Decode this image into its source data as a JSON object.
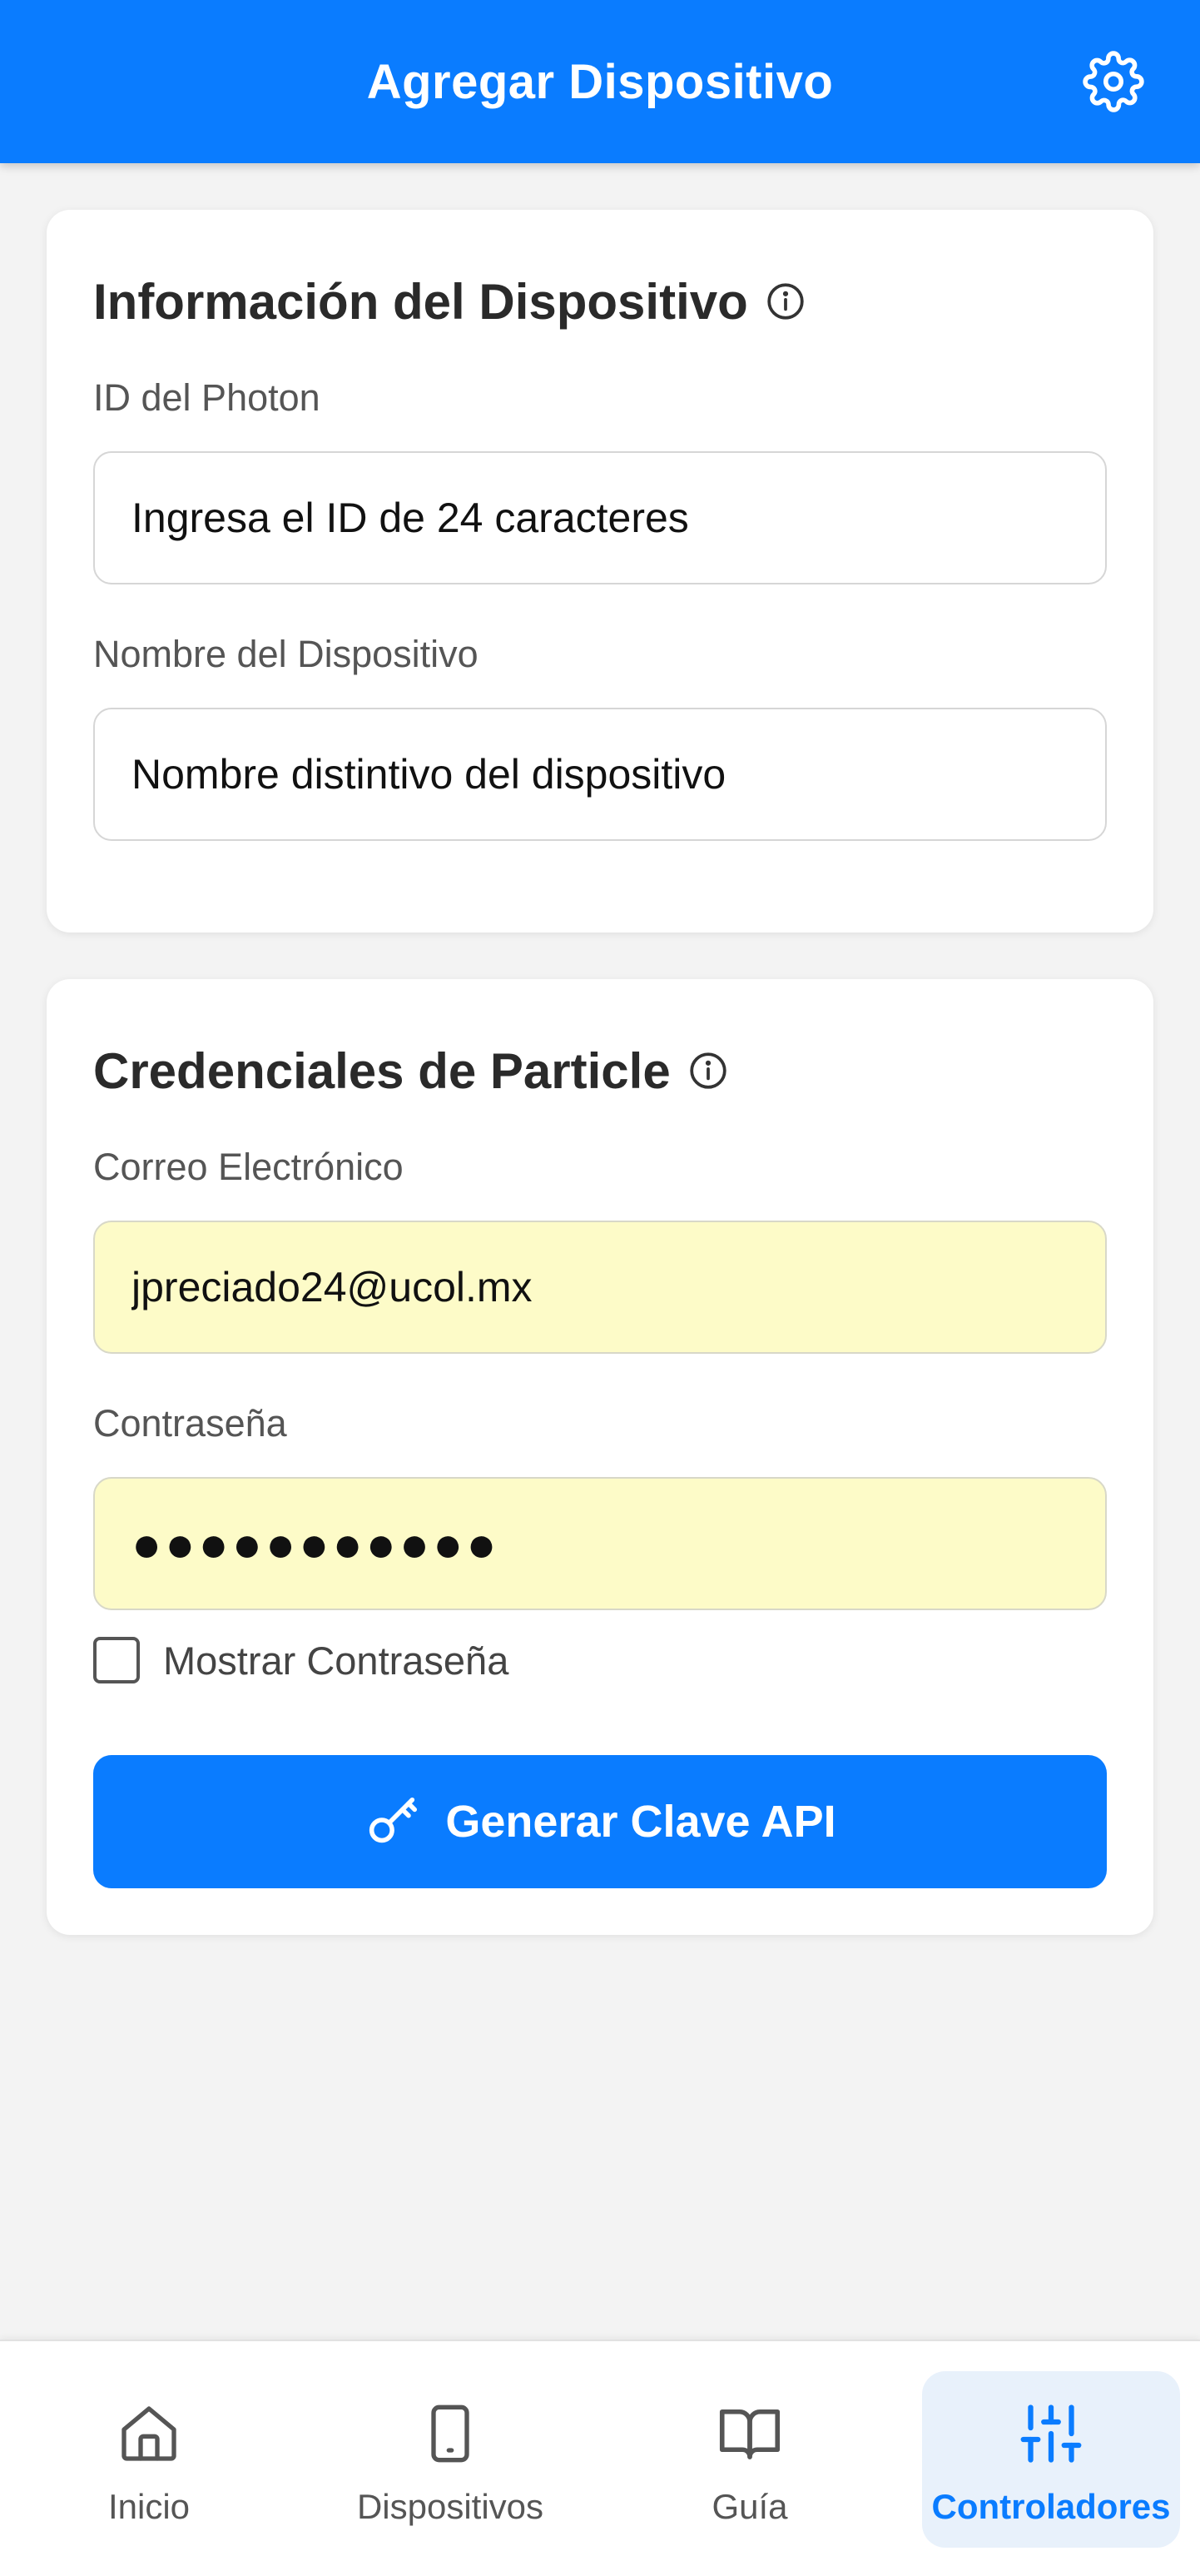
{
  "header": {
    "title": "Agregar Dispositivo"
  },
  "device_info": {
    "title": "Información del Dispositivo",
    "photon_id_label": "ID del Photon",
    "photon_id_placeholder": "Ingresa el ID de 24 caracteres",
    "device_name_label": "Nombre del Dispositivo",
    "device_name_placeholder": "Nombre distintivo del dispositivo"
  },
  "credentials": {
    "title": "Credenciales de Particle",
    "email_label": "Correo Electrónico",
    "email_value": "jpreciado24@ucol.mx",
    "password_label": "Contraseña",
    "password_masked": "●●●●●●●●●●●",
    "show_password_label": "Mostrar Contraseña",
    "show_password_checked": false,
    "generate_button_label": "Generar Clave API"
  },
  "nav": {
    "items": [
      {
        "label": "Inicio",
        "icon": "home-icon"
      },
      {
        "label": "Dispositivos",
        "icon": "phone-icon"
      },
      {
        "label": "Guía",
        "icon": "book-icon"
      },
      {
        "label": "Controladores",
        "icon": "sliders-icon",
        "active": true
      }
    ]
  },
  "colors": {
    "primary": "#0a7cff",
    "autofill_bg": "#fdfbc8",
    "active_nav_bg": "#e8f1fb"
  }
}
